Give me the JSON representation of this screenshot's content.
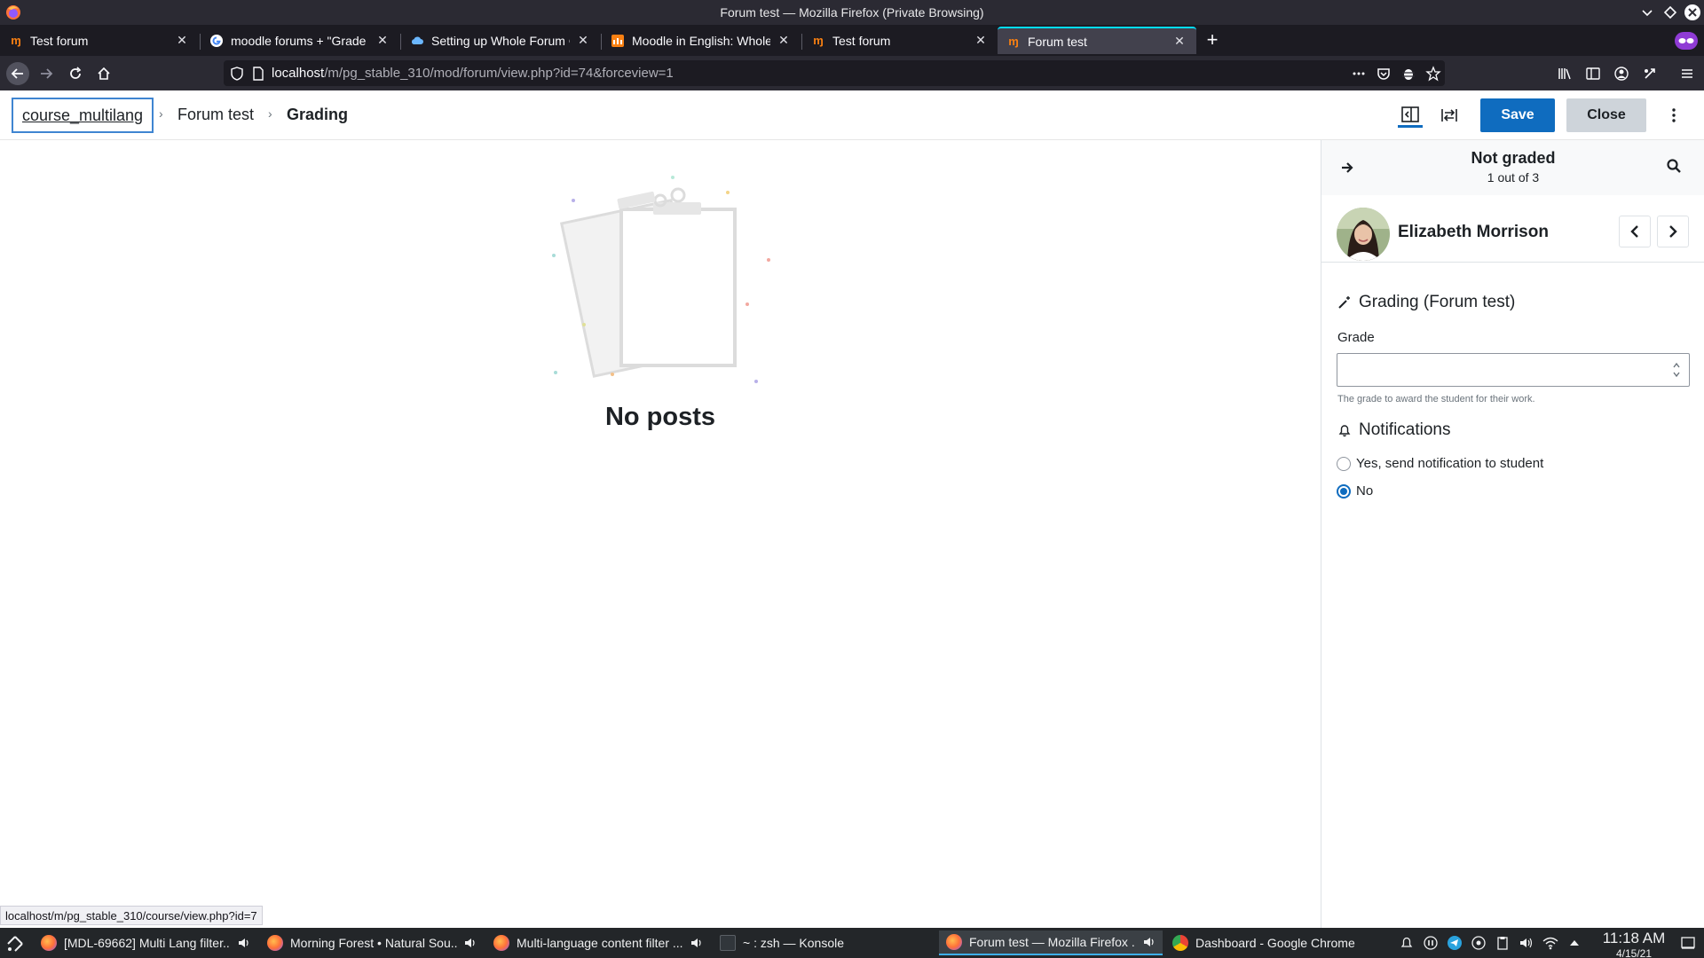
{
  "window": {
    "title": "Forum test — Mozilla Firefox (Private Browsing)"
  },
  "tabs": [
    {
      "label": "Test forum",
      "favicon": "moodle-icon"
    },
    {
      "label": "moodle forums + \"Grade u",
      "favicon": "google-icon"
    },
    {
      "label": "Setting up Whole Forum G",
      "favicon": "cloud-icon"
    },
    {
      "label": "Moodle in English: Whole F",
      "favicon": "moodle-orange-icon"
    },
    {
      "label": "Test forum",
      "favicon": "moodle-icon"
    },
    {
      "label": "Forum test",
      "favicon": "moodle-icon",
      "active": true
    }
  ],
  "navbar": {
    "url_host": "localhost",
    "url_path": "/m/pg_stable_310/mod/forum/view.php?id=74&forceview=1"
  },
  "header": {
    "breadcrumb": [
      "course_multilang",
      "Forum test",
      "Grading"
    ],
    "save_label": "Save",
    "close_label": "Close"
  },
  "main": {
    "empty_message": "No posts"
  },
  "panel": {
    "status_title": "Not graded",
    "status_count": "1 out of 3",
    "user_name": "Elizabeth Morrison",
    "grading_title": "Grading (Forum test)",
    "grade_label": "Grade",
    "grade_value": "",
    "grade_help": "The grade to award the student for their work.",
    "notifications_title": "Notifications",
    "notify_options": [
      {
        "label": "Yes, send notification to student",
        "checked": false
      },
      {
        "label": "No",
        "checked": true
      }
    ]
  },
  "statusbar": {
    "link": "localhost/m/pg_stable_310/course/view.php?id=7"
  },
  "taskbar": {
    "tasks": [
      {
        "label": "[MDL-69662] Multi Lang filter...",
        "icon": "firefox-icon",
        "audio": true
      },
      {
        "label": "Morning Forest • Natural Sou...",
        "icon": "firefox-icon",
        "audio": true
      },
      {
        "label": "Multi-language content filter ...",
        "icon": "firefox-icon",
        "audio": true
      },
      {
        "label": "~ : zsh — Konsole",
        "icon": "terminal-icon",
        "audio": false
      },
      {
        "label": "Forum test — Mozilla Firefox ...",
        "icon": "firefox-icon",
        "audio": true,
        "active": true
      },
      {
        "label": "Dashboard - Google Chrome",
        "icon": "chrome-icon",
        "audio": false
      }
    ],
    "time": "11:18 AM",
    "date": "4/15/21"
  },
  "colors": {
    "primary": "#0f6cbf",
    "firefox_dark": "#2b2a33",
    "tab_strip": "#1c1b22",
    "taskbar": "#232629"
  }
}
